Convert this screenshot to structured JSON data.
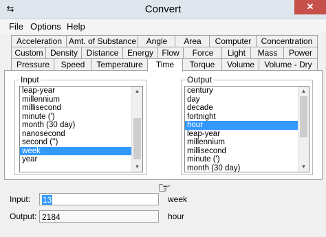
{
  "window": {
    "title": "Convert",
    "close_label": "✕"
  },
  "menu": {
    "items": [
      "File",
      "Options",
      "Help"
    ]
  },
  "tabs": {
    "row1": [
      "Acceleration",
      "Amt. of Substance",
      "Angle",
      "Area",
      "Computer",
      "Concentration"
    ],
    "row2": [
      "Custom",
      "Density",
      "Distance",
      "Energy",
      "Flow",
      "Force",
      "Light",
      "Mass",
      "Power"
    ],
    "row3": [
      "Pressure",
      "Speed",
      "Temperature",
      "Time",
      "Torque",
      "Volume",
      "Volume - Dry"
    ],
    "active": "Time"
  },
  "input_group": {
    "label": "Input",
    "items": [
      "leap-year",
      "millennium",
      "millisecond",
      "minute (')",
      "month (30 day)",
      "nanosecond",
      "second ('')",
      "week",
      "year"
    ],
    "selected": "week"
  },
  "output_group": {
    "label": "Output",
    "items": [
      "century",
      "day",
      "decade",
      "fortnight",
      "hour",
      "leap-year",
      "millennium",
      "millisecond",
      "minute (')",
      "month (30 day)"
    ],
    "selected": "hour"
  },
  "pointer_icon": "pointing-hand-icon",
  "fields": {
    "input_label": "Input:",
    "input_value": "13",
    "input_unit": "week",
    "output_label": "Output:",
    "output_value": "2184",
    "output_unit": "hour"
  },
  "colors": {
    "selection": "#3399ff",
    "close": "#c7504a",
    "title_bar": "#dfe6ee"
  }
}
